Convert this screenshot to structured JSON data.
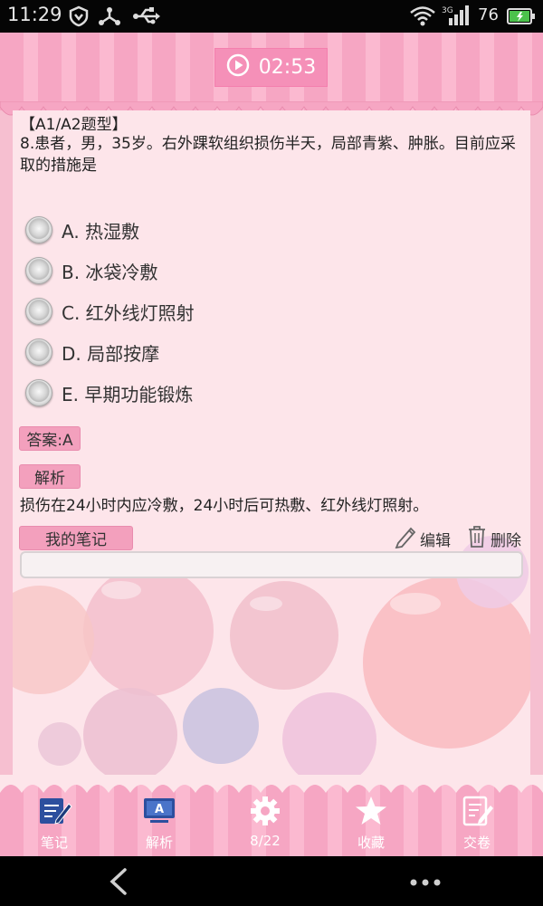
{
  "status_bar": {
    "time": "11:29",
    "signal_label": "3G",
    "battery": "76"
  },
  "timer": {
    "value": "02:53"
  },
  "question": {
    "type": "【A1/A2题型】",
    "stem": "8.患者，男，35岁。右外踝软组织损伤半天，局部青紫、肿胀。目前应采取的措施是",
    "options": [
      {
        "label": "A. 热湿敷"
      },
      {
        "label": "B. 冰袋冷敷"
      },
      {
        "label": "C. 红外线灯照射"
      },
      {
        "label": "D. 局部按摩"
      },
      {
        "label": "E. 早期功能锻炼"
      }
    ]
  },
  "answer": {
    "label": "答案:A"
  },
  "explanation": {
    "title": "解析",
    "text": "损伤在24小时内应冷敷，24小时后可热敷、红外线灯照射。"
  },
  "notes": {
    "title": "我的笔记",
    "edit_label": "编辑",
    "delete_label": "删除",
    "value": ""
  },
  "bottom_tabs": [
    {
      "label": "笔记",
      "icon": "note-edit-icon"
    },
    {
      "label": "解析",
      "icon": "analysis-monitor-icon"
    },
    {
      "label": "8/22",
      "icon": "gear-icon"
    },
    {
      "label": "收藏",
      "icon": "star-icon"
    },
    {
      "label": "交卷",
      "icon": "submit-paper-icon"
    }
  ],
  "colors": {
    "awning_pink": "#f6a6c3",
    "panel_bg": "#fde5ea",
    "tag_pink": "#f3a0bd",
    "icon_blue": "#2c4f9e"
  }
}
